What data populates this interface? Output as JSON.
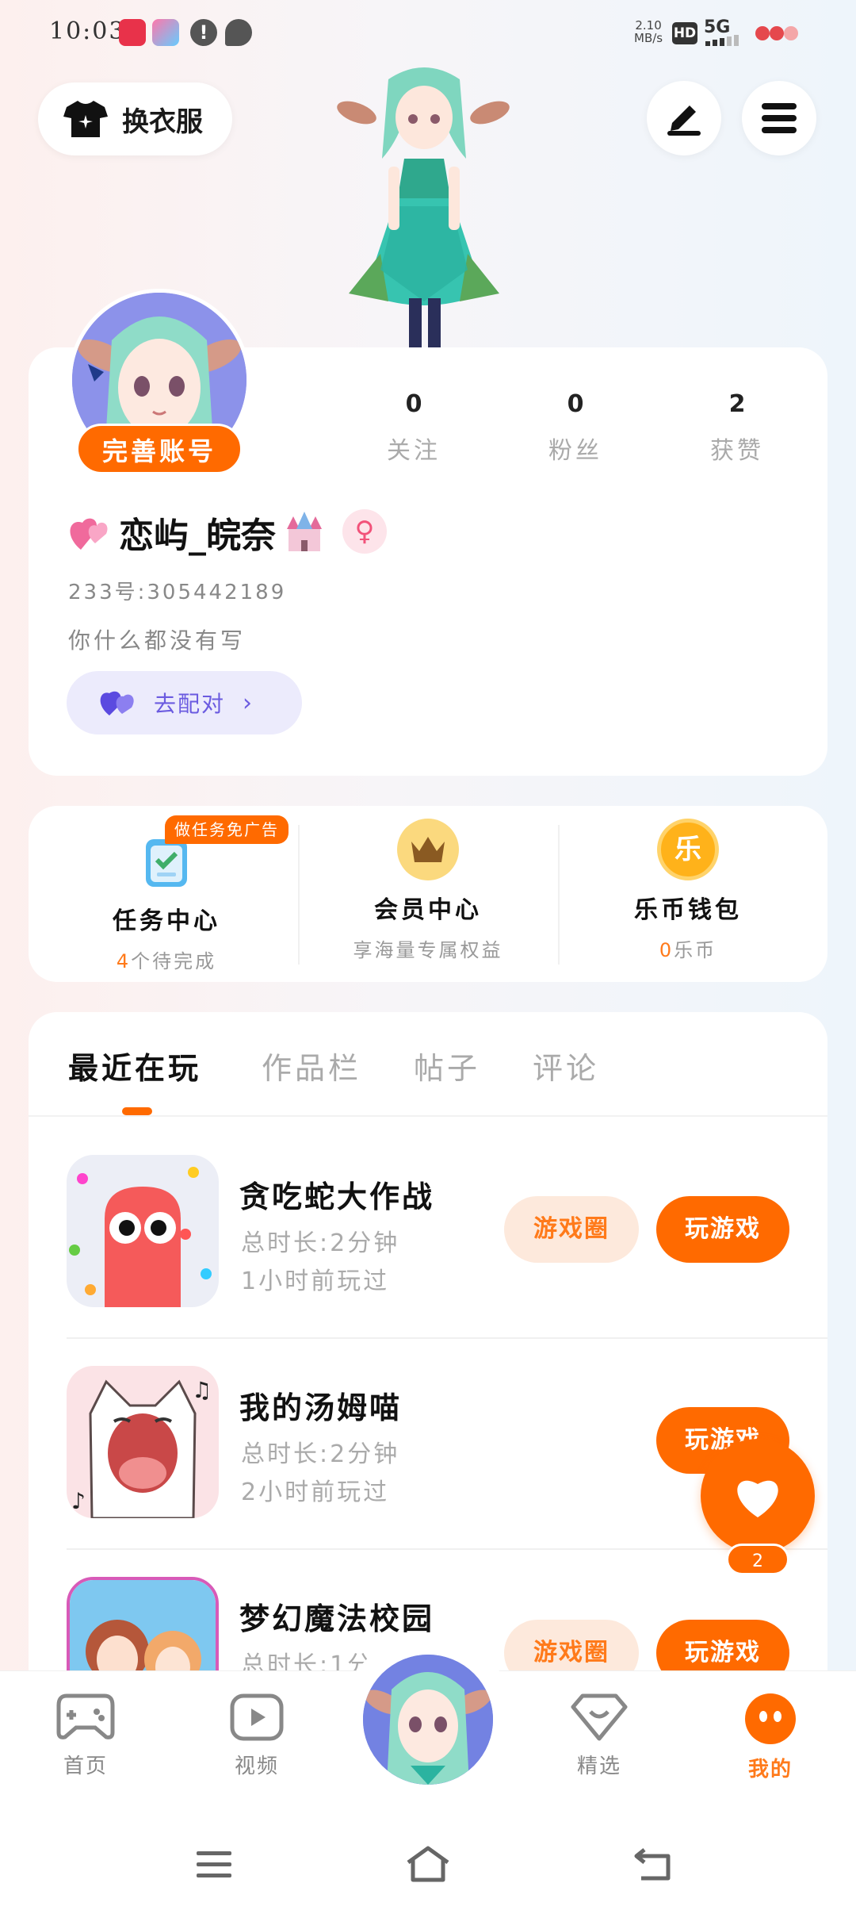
{
  "status_bar": {
    "time": "10:03",
    "net_speed_value": "2.10",
    "net_speed_unit": "MB/s",
    "hd": "HD",
    "network": "5G"
  },
  "header": {
    "outfit_label": "换衣服",
    "edit_icon": "edit-icon",
    "menu_icon": "menu-icon"
  },
  "profile": {
    "complete_account_label": "完善账号",
    "stats": [
      {
        "value": "0",
        "label": "关注"
      },
      {
        "value": "0",
        "label": "粉丝"
      },
      {
        "value": "2",
        "label": "获赞"
      }
    ],
    "username": "恋屿_皖奈",
    "gender_symbol": "♀",
    "uid": "233号:305442189",
    "bio": "你什么都没有写",
    "match_label": "去配对"
  },
  "services": {
    "task_tag": "做任务免广告",
    "items": [
      {
        "title": "任务中心",
        "sub_count": "4",
        "sub_text": "个待完成"
      },
      {
        "title": "会员中心",
        "sub_text": "享海量专属权益"
      },
      {
        "title": "乐币钱包",
        "sub_count": "0",
        "sub_text": "乐币",
        "icon_char": "乐"
      }
    ]
  },
  "tabs": [
    {
      "label": "最近在玩",
      "active": true
    },
    {
      "label": "作品栏",
      "active": false
    },
    {
      "label": "帖子",
      "active": false
    },
    {
      "label": "评论",
      "active": false
    }
  ],
  "games": [
    {
      "name": "贪吃蛇大作战",
      "duration": "总时长:2分钟",
      "last_played": "1小时前玩过",
      "pic_label": "游戏圈",
      "play_label": "玩游戏"
    },
    {
      "name": "我的汤姆喵",
      "duration": "总时长:2分钟",
      "last_played": "2小时前玩过",
      "play_label": "玩游戏"
    },
    {
      "name": "梦幻魔法校园",
      "duration": "总时长:1分",
      "pic_label": "游戏圈",
      "play_label": "玩游戏"
    }
  ],
  "fab": {
    "count": "2"
  },
  "bottom_nav": [
    {
      "label": "首页",
      "icon": "gamepad-icon"
    },
    {
      "label": "视频",
      "icon": "video-icon"
    },
    {
      "label": "精选",
      "icon": "heart-diamond-icon"
    },
    {
      "label": "我的",
      "icon": "profile-face-icon",
      "active": true
    }
  ],
  "colors": {
    "accent": "#ff6a00",
    "purple": "#6b5be0"
  }
}
